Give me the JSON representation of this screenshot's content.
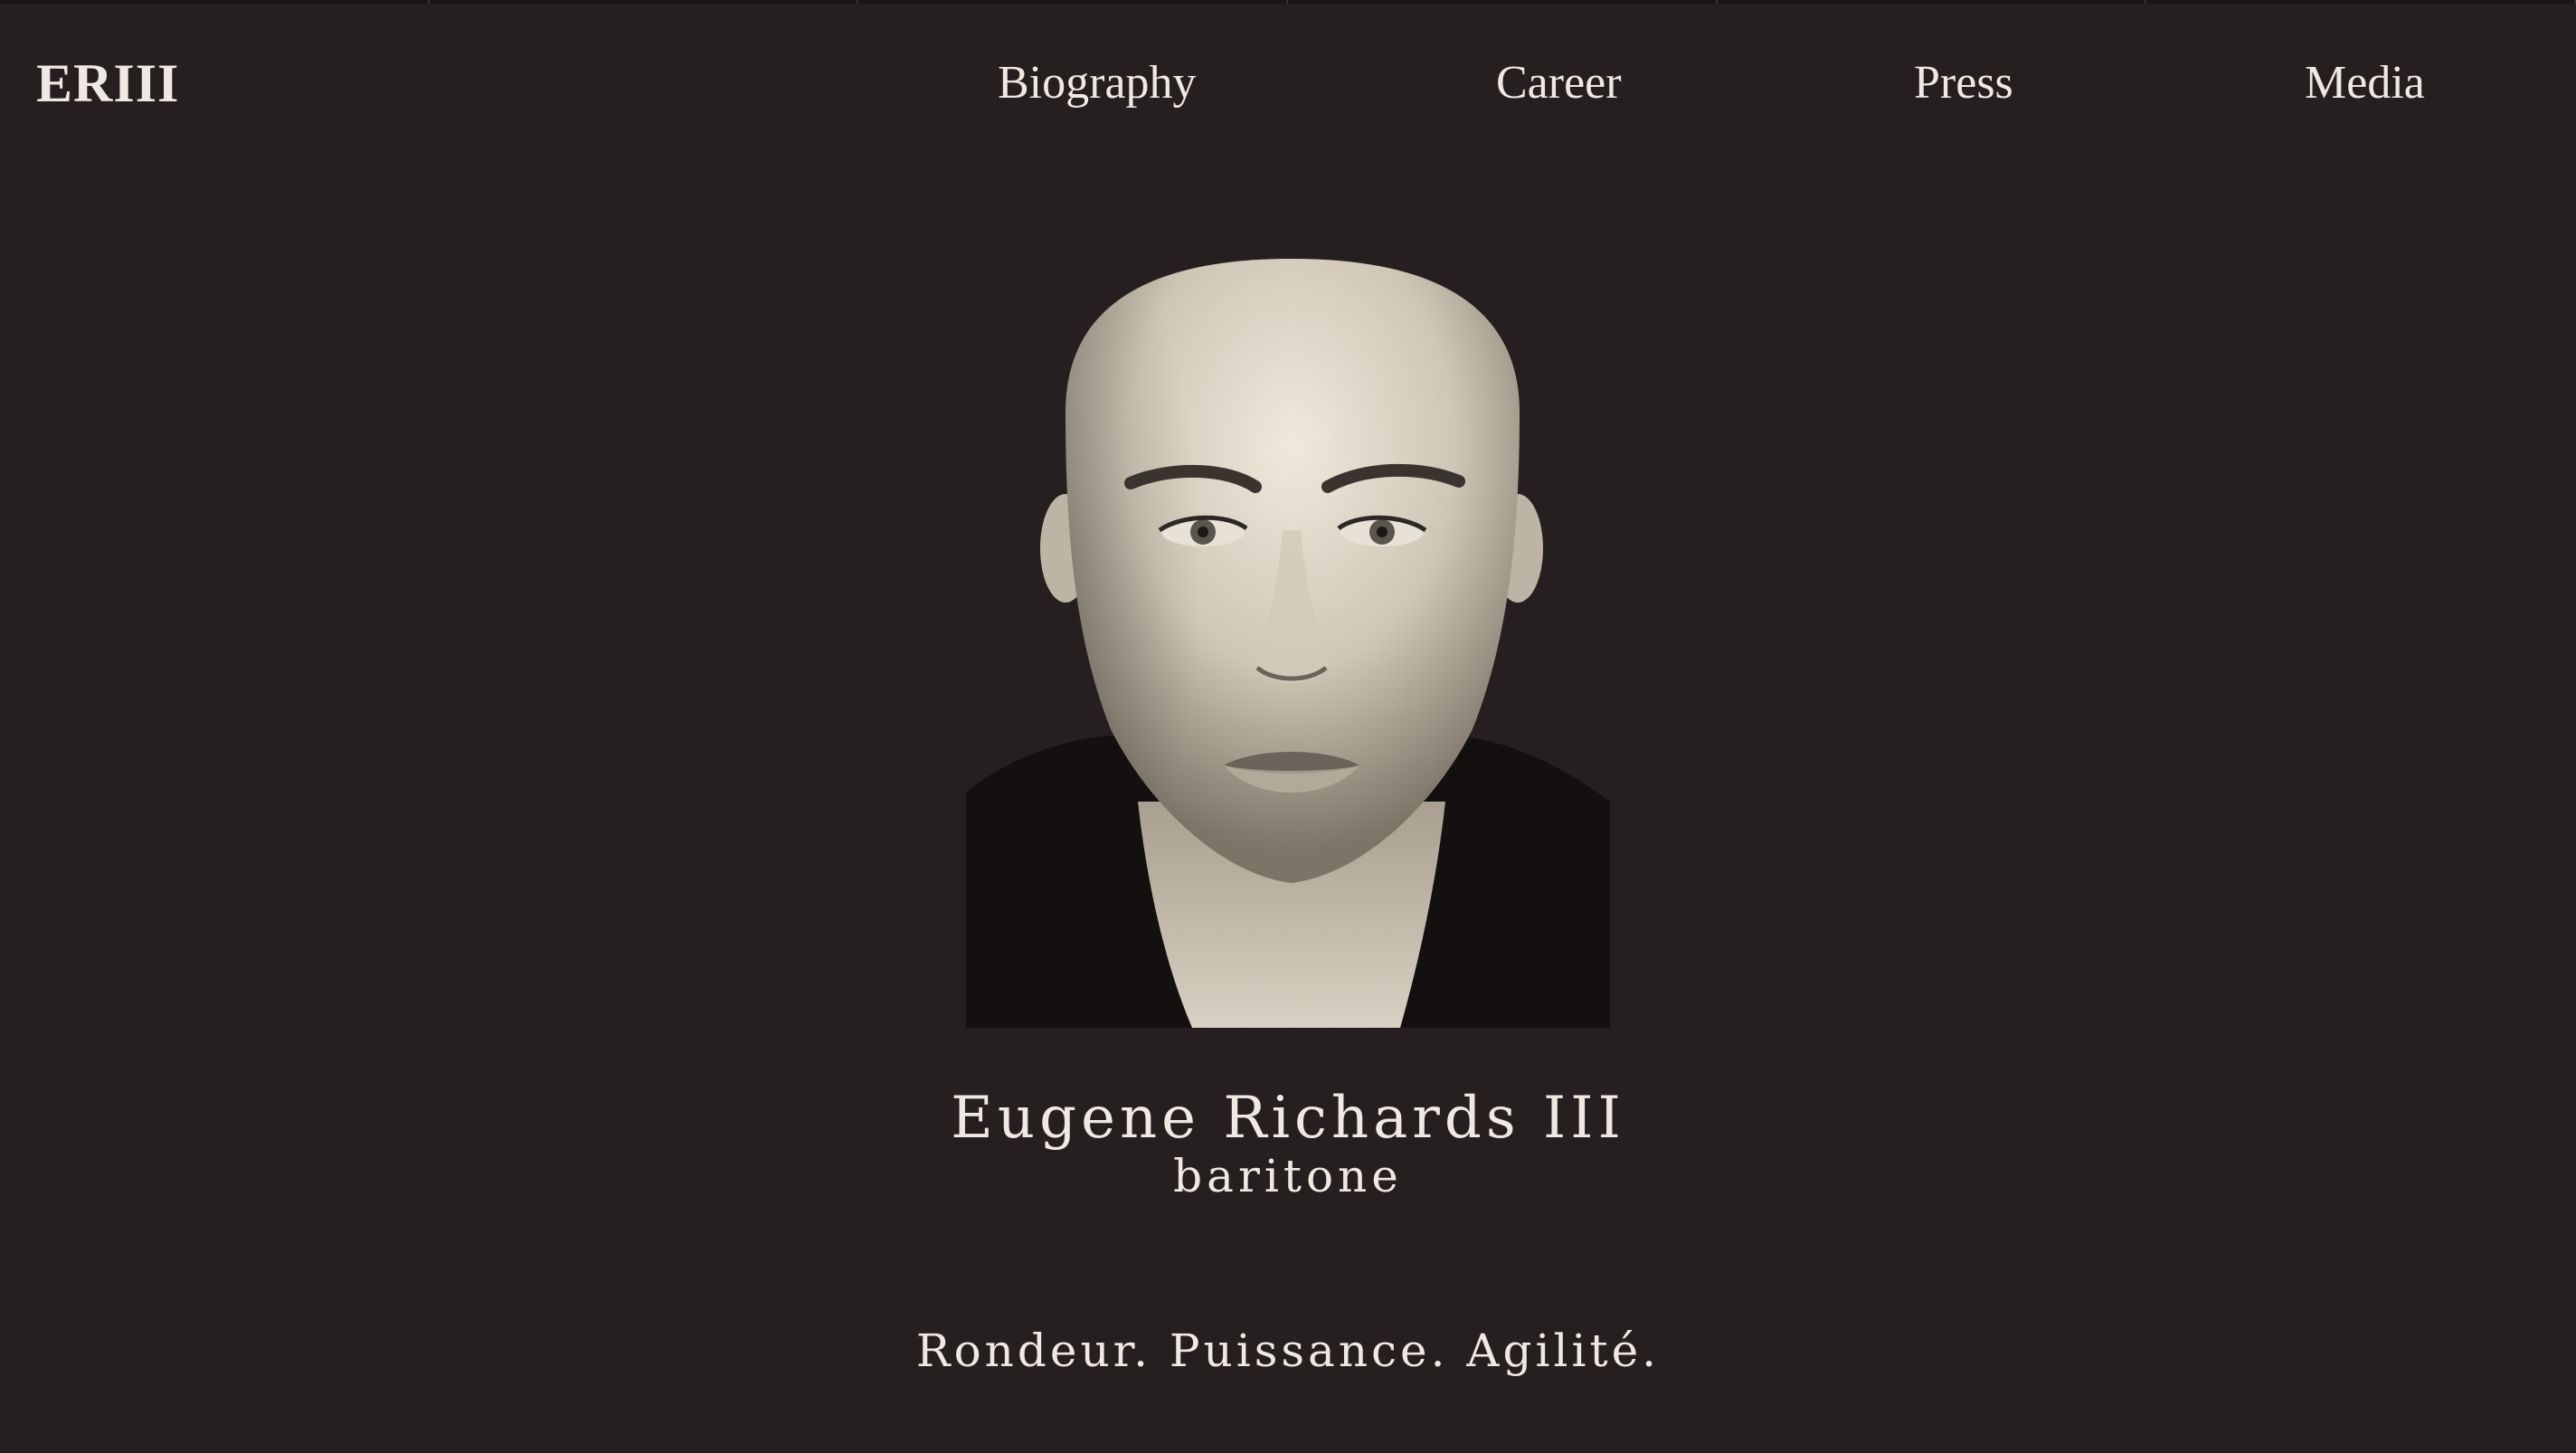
{
  "site": {
    "logo": "ERIII",
    "nav": [
      {
        "label": "Biography"
      },
      {
        "label": "Career"
      },
      {
        "label": "Press"
      },
      {
        "label": "Media"
      }
    ]
  },
  "hero": {
    "name": "Eugene Richards III",
    "voice_type": "baritone",
    "tagline": "Rondeur. Puissance. Agilité.",
    "portrait_subject": "black-and-white headshot"
  },
  "colors": {
    "background": "#261f1f",
    "text": "#efe9e3"
  }
}
